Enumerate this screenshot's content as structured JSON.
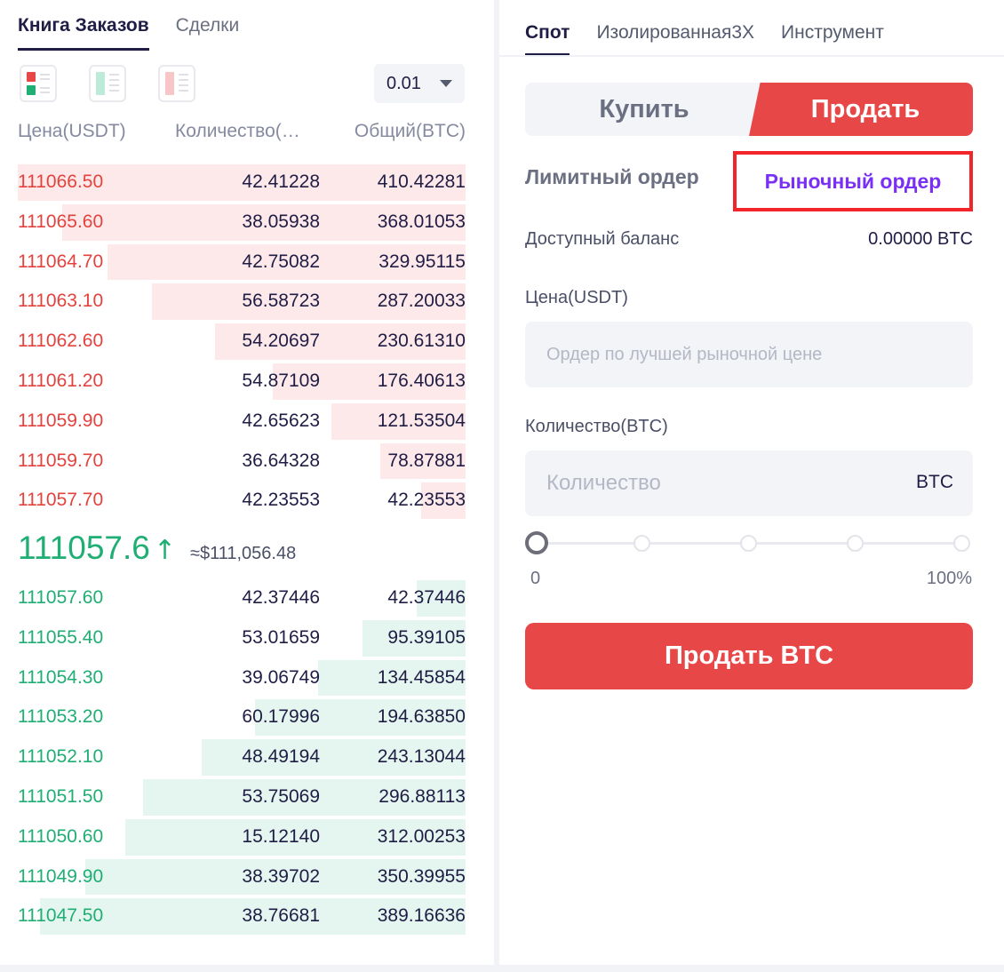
{
  "orderbook": {
    "tabs": [
      {
        "label": "Книга Заказов",
        "active": true
      },
      {
        "label": "Сделки",
        "active": false
      }
    ],
    "precision": "0.01",
    "headers": {
      "price": "Цена(USDT)",
      "qty": "Количество(…",
      "total": "Общий(BTC)"
    },
    "asks": [
      {
        "price": "111066.50",
        "qty": "42.41228",
        "total": "410.42281",
        "depth": 1.0
      },
      {
        "price": "111065.60",
        "qty": "38.05938",
        "total": "368.01053",
        "depth": 0.9
      },
      {
        "price": "111064.70",
        "qty": "42.75082",
        "total": "329.95115",
        "depth": 0.8
      },
      {
        "price": "111063.10",
        "qty": "56.58723",
        "total": "287.20033",
        "depth": 0.7
      },
      {
        "price": "111062.60",
        "qty": "54.20697",
        "total": "230.61310",
        "depth": 0.56
      },
      {
        "price": "111061.20",
        "qty": "54.87109",
        "total": "176.40613",
        "depth": 0.43
      },
      {
        "price": "111059.90",
        "qty": "42.65623",
        "total": "121.53504",
        "depth": 0.3
      },
      {
        "price": "111059.70",
        "qty": "36.64328",
        "total": "78.87881",
        "depth": 0.19
      },
      {
        "price": "111057.70",
        "qty": "42.23553",
        "total": "42.23553",
        "depth": 0.1
      }
    ],
    "last": {
      "price": "111057.6",
      "arrow": "↑",
      "usd": "≈$111,056.48"
    },
    "bids": [
      {
        "price": "111057.60",
        "qty": "42.37446",
        "total": "42.37446",
        "depth": 0.11
      },
      {
        "price": "111055.40",
        "qty": "53.01659",
        "total": "95.39105",
        "depth": 0.23
      },
      {
        "price": "111054.30",
        "qty": "39.06749",
        "total": "134.45854",
        "depth": 0.33
      },
      {
        "price": "111053.20",
        "qty": "60.17996",
        "total": "194.63850",
        "depth": 0.47
      },
      {
        "price": "111052.10",
        "qty": "48.49194",
        "total": "243.13044",
        "depth": 0.59
      },
      {
        "price": "111051.50",
        "qty": "53.75069",
        "total": "296.88113",
        "depth": 0.72
      },
      {
        "price": "111050.60",
        "qty": "15.12140",
        "total": "312.00253",
        "depth": 0.76
      },
      {
        "price": "111049.90",
        "qty": "38.39702",
        "total": "350.39955",
        "depth": 0.85
      },
      {
        "price": "111047.50",
        "qty": "38.76681",
        "total": "389.16636",
        "depth": 0.95
      }
    ]
  },
  "trade": {
    "market_tabs": [
      {
        "label": "Спот",
        "active": true
      },
      {
        "label": "Изолированная3X",
        "active": false
      },
      {
        "label": "Инструмент",
        "active": false
      }
    ],
    "buy_label": "Купить",
    "sell_label": "Продать",
    "limit_label": "Лимитный ордер",
    "market_label": "Рыночный ордер",
    "balance_label": "Доступный баланс",
    "balance_value": "0.00000 BTC",
    "price_label": "Цена(USDT)",
    "price_placeholder": "Ордер по лучшей рыночной цене",
    "qty_label": "Количество(BTC)",
    "qty_placeholder": "Количество",
    "qty_unit": "BTC",
    "slider_min": "0",
    "slider_max": "100%",
    "slider_value": 0,
    "submit_label": "Продать BTC"
  },
  "colors": {
    "sell": "#e84747",
    "buy": "#1fae74",
    "accent": "#7a2ff5",
    "highlight_box": "#f2262a"
  }
}
